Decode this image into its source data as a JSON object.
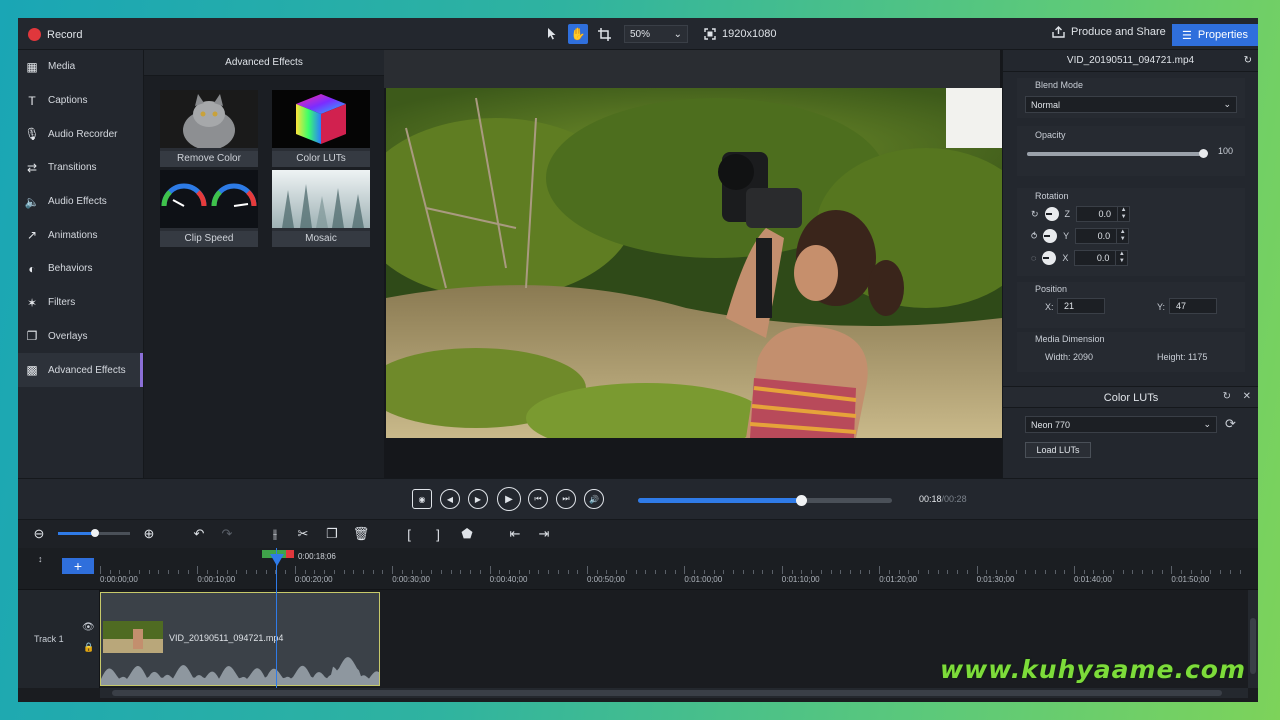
{
  "topbar": {
    "record_label": "Record",
    "zoom_value": "50%",
    "resolution": "1920x1080",
    "produce_label": "Produce and Share",
    "properties_label": "Properties"
  },
  "sidebar": {
    "items": [
      {
        "label": "Media",
        "icon": "media-icon",
        "glyph": "▦"
      },
      {
        "label": "Captions",
        "icon": "captions-icon",
        "glyph": "T"
      },
      {
        "label": "Audio Recorder",
        "icon": "microphone-icon",
        "glyph": "🎙"
      },
      {
        "label": "Transitions",
        "icon": "transitions-icon",
        "glyph": "⇄"
      },
      {
        "label": "Audio Effects",
        "icon": "speaker-icon",
        "glyph": "🔈"
      },
      {
        "label": "Animations",
        "icon": "animations-icon",
        "glyph": "↗"
      },
      {
        "label": "Behaviors",
        "icon": "behaviors-icon",
        "glyph": "◐"
      },
      {
        "label": "Filters",
        "icon": "filters-icon",
        "glyph": "✶"
      },
      {
        "label": "Overlays",
        "icon": "overlays-icon",
        "glyph": "❐"
      },
      {
        "label": "Advanced Effects",
        "icon": "advanced-effects-icon",
        "glyph": "▩"
      }
    ],
    "active_index": 9
  },
  "effects": {
    "title": "Advanced Effects",
    "tiles": [
      {
        "label": "Remove Color"
      },
      {
        "label": "Color LUTs"
      },
      {
        "label": "Clip Speed"
      },
      {
        "label": "Mosaic"
      }
    ]
  },
  "properties": {
    "file_name": "VID_20190511_094721.mp4",
    "blend_mode_label": "Blend Mode",
    "blend_mode_value": "Normal",
    "opacity_label": "Opacity",
    "opacity_value": "100",
    "opacity_fraction": 1.0,
    "rotation_label": "Rotation",
    "rotation": [
      {
        "axis": "Z",
        "value": "0.0"
      },
      {
        "axis": "Y",
        "value": "0.0"
      },
      {
        "axis": "X",
        "value": "0.0"
      }
    ],
    "position_label": "Position",
    "pos_x_label": "X:",
    "pos_x": "21",
    "pos_y_label": "Y:",
    "pos_y": "47",
    "media_dim_label": "Media Dimension",
    "width_text": "Width: 2090",
    "height_text": "Height: 1175"
  },
  "luts": {
    "title": "Color LUTs",
    "preset": "Neon 770",
    "load_label": "Load LUTs"
  },
  "transport": {
    "current_time": "00:18",
    "total_time": "00:28",
    "progress_fraction": 0.64
  },
  "timeline": {
    "playhead_time": "0:00:18;06",
    "ticks": [
      "0:00:00;00",
      "0:00:10;00",
      "0:00:20;00",
      "0:00:30;00",
      "0:00:40;00",
      "0:00:50;00",
      "0:01:00;00",
      "0:01:10;00",
      "0:01:20;00",
      "0:01:30;00",
      "0:01:40;00",
      "0:01:50;00"
    ],
    "track_label": "Track 1",
    "clip_name": "VID_20190511_094721.mp4"
  },
  "watermark": "www.kuhyaame.com",
  "colors": {
    "accent": "#2f6fdc",
    "record": "#e0373c",
    "active_border": "#8b6fd6"
  }
}
